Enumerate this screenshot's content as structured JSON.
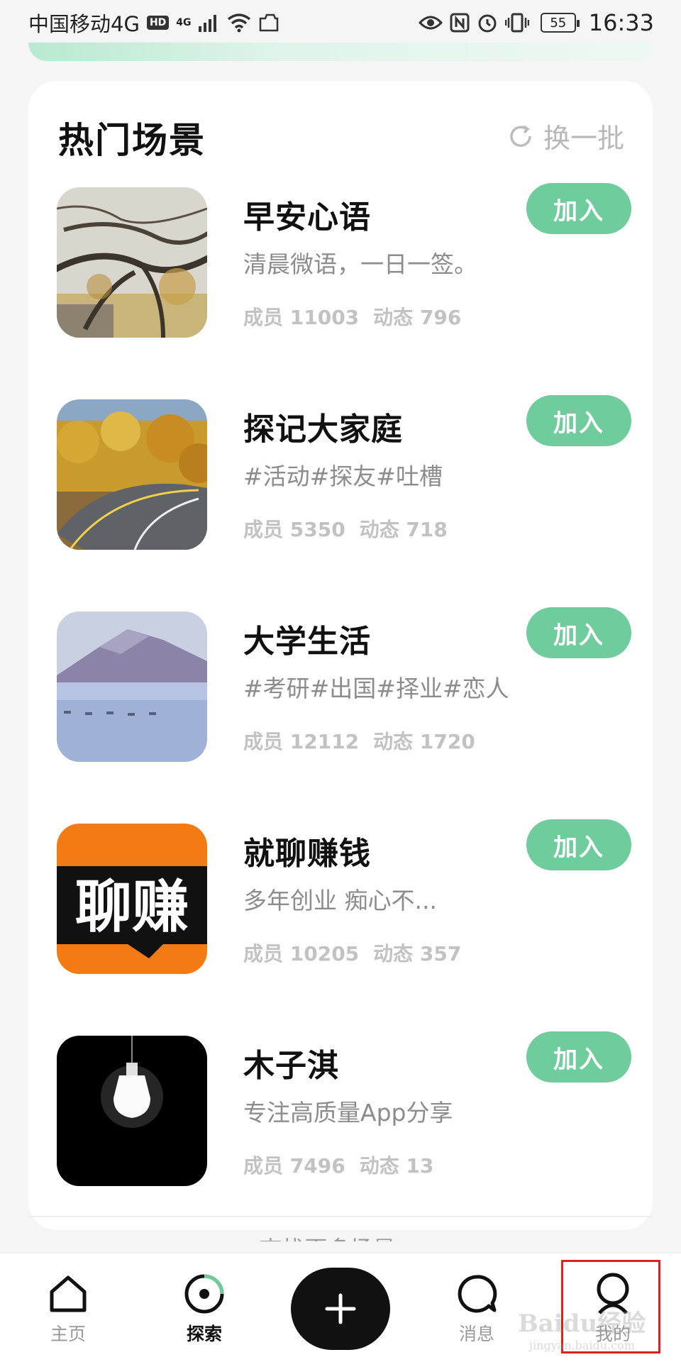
{
  "status_bar": {
    "carrier": "中国移动4G",
    "hd_badge": "HD",
    "signal_label": "4G",
    "battery": "55",
    "time": "16:33"
  },
  "section": {
    "title": "热门场景",
    "refresh_label": "换一批"
  },
  "scenes": [
    {
      "name": "早安心语",
      "desc": "清晨微语，一日一签。",
      "members": "成员 11003",
      "posts": "动态 796",
      "join_label": "加入",
      "thumb": "tree-branches"
    },
    {
      "name": "探记大家庭",
      "desc": "#活动#探友#吐槽",
      "members": "成员 5350",
      "posts": "动态 718",
      "join_label": "加入",
      "thumb": "autumn-road"
    },
    {
      "name": "大学生活",
      "desc": "#考研#出国#择业#恋人",
      "members": "成员 12112",
      "posts": "动态 1720",
      "join_label": "加入",
      "thumb": "mountain-lake"
    },
    {
      "name": "就聊赚钱",
      "desc": "多年创业 痴心不...",
      "members": "成员 10205",
      "posts": "动态 357",
      "join_label": "加入",
      "thumb": "orange-text-logo",
      "thumb_text": "聊赚"
    },
    {
      "name": "木子淇",
      "desc": "专注高质量App分享",
      "members": "成员 7496",
      "posts": "动态 13",
      "join_label": "加入",
      "thumb": "light-bulb"
    }
  ],
  "more_link": "查找更多场景 >",
  "bottom_nav": {
    "items": [
      {
        "label": "主页",
        "icon": "home-icon",
        "active": false
      },
      {
        "label": "探索",
        "icon": "explore-icon",
        "active": true
      },
      {
        "label": "消息",
        "icon": "message-icon",
        "active": false
      },
      {
        "label": "我的",
        "icon": "profile-icon",
        "active": false
      }
    ],
    "fab_icon": "plus-icon"
  },
  "watermark": {
    "text": "Baidu经验",
    "sub": "jingyan.baidu.com"
  },
  "colors": {
    "accent": "#6fcc9c",
    "highlight": "#e02020",
    "fab": "#111111"
  }
}
